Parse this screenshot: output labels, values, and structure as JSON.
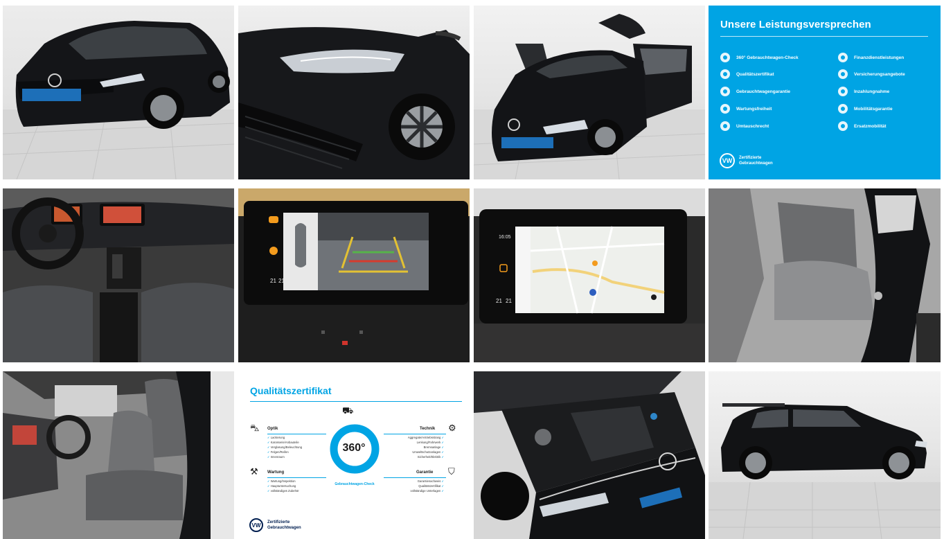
{
  "gallery": {
    "tiles": [
      {
        "id": 1,
        "kind": "photo",
        "subject": "car-front-three-quarter"
      },
      {
        "id": 2,
        "kind": "photo",
        "subject": "headlight-detail"
      },
      {
        "id": 3,
        "kind": "photo",
        "subject": "car-doors-open"
      },
      {
        "id": 4,
        "kind": "info"
      },
      {
        "id": 5,
        "kind": "photo",
        "subject": "cockpit-interior"
      },
      {
        "id": 6,
        "kind": "photo",
        "subject": "rear-camera-display"
      },
      {
        "id": 7,
        "kind": "photo",
        "subject": "navigation-display"
      },
      {
        "id": 8,
        "kind": "photo",
        "subject": "rear-seats"
      },
      {
        "id": 9,
        "kind": "photo",
        "subject": "front-seats"
      },
      {
        "id": 10,
        "kind": "info"
      },
      {
        "id": 11,
        "kind": "photo",
        "subject": "engine-bay"
      },
      {
        "id": 12,
        "kind": "photo",
        "subject": "car-side-profile"
      }
    ]
  },
  "promise": {
    "title": "Unsere Leistungsversprechen",
    "left_items": [
      "360° Gebrauchtwagen-Check",
      "Qualitätszertifikat",
      "Gebrauchtwagengarantie",
      "Wartungsfreiheit",
      "Umtauschrecht"
    ],
    "right_items": [
      "Finanzdienstleistungen",
      "Versicherungsangebote",
      "Inzahlungnahme",
      "Mobilitätsgarantie",
      "Ersatzmobilität"
    ],
    "footer_line1": "Zertifizierte",
    "footer_line2": "Gebrauchtwagen",
    "logo_text": "VW"
  },
  "quality": {
    "title": "Qualitätszertifikat",
    "center_value": "360°",
    "ring_text": "Gebrauchtwagen-Check",
    "optik": {
      "title": "Optik",
      "items": [
        "Lackierung",
        "Karosserie/Anbauteile",
        "Verglasung/Beleuchtung",
        "Felgen/Reifen",
        "Innenraum"
      ]
    },
    "technik": {
      "title": "Technik",
      "items": [
        "Aggregate/Antriebsstrang",
        "Lenkung/Fahrwerk",
        "Bremsanlage",
        "Umweltschutzanlagen",
        "Sicherheit/Elektrik"
      ]
    },
    "wartung": {
      "title": "Wartung",
      "items": [
        "Wartung/Inspektion",
        "Hauptuntersuchung",
        "vollständiges Zubehör"
      ]
    },
    "garantie": {
      "title": "Garantie",
      "items": [
        "Garantienachweis",
        "Qualitätszertifikat",
        "vollständige Unterlagen"
      ]
    },
    "footer_line1": "Zertifizierte",
    "footer_line2": "Gebrauchtwagen",
    "logo_text": "VW"
  },
  "screens": {
    "temp_left": "21",
    "temp_right": "21",
    "nav_time": "16:05"
  },
  "colors": {
    "vw_blue": "#00a4e4",
    "vw_dark": "#001e50",
    "car_black": "#111214"
  }
}
